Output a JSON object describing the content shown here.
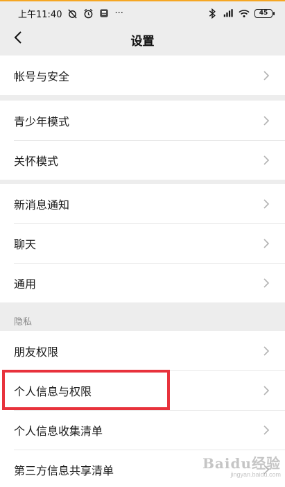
{
  "status_bar": {
    "time": "上午11:40",
    "more": "···",
    "battery": "45",
    "icons": [
      "alarm-off-icon",
      "alarm-clock-icon",
      "notes-app-icon",
      "bluetooth-icon",
      "hd-signal-icon",
      "wifi-icon",
      "battery-icon"
    ]
  },
  "nav": {
    "title": "设置",
    "back_icon": "chevron-left-icon"
  },
  "groups": [
    {
      "items": [
        {
          "label": "帐号与安全"
        }
      ]
    },
    {
      "items": [
        {
          "label": "青少年模式"
        },
        {
          "label": "关怀模式"
        }
      ]
    },
    {
      "items": [
        {
          "label": "新消息通知"
        },
        {
          "label": "聊天"
        },
        {
          "label": "通用"
        }
      ]
    },
    {
      "section_label": "隐私",
      "items": [
        {
          "label": "朋友权限"
        },
        {
          "label": "个人信息与权限"
        },
        {
          "label": "个人信息收集清单"
        },
        {
          "label": "第三方信息共享清单"
        }
      ]
    }
  ],
  "highlight": {
    "target": "个人信息与权限",
    "color": "#e8323c"
  },
  "watermark": {
    "text": "Baidu经验",
    "sub": "jingyan.baidu.com"
  },
  "colors": {
    "background": "#ededed",
    "card": "#ffffff",
    "accent_top": "#f5a623"
  }
}
